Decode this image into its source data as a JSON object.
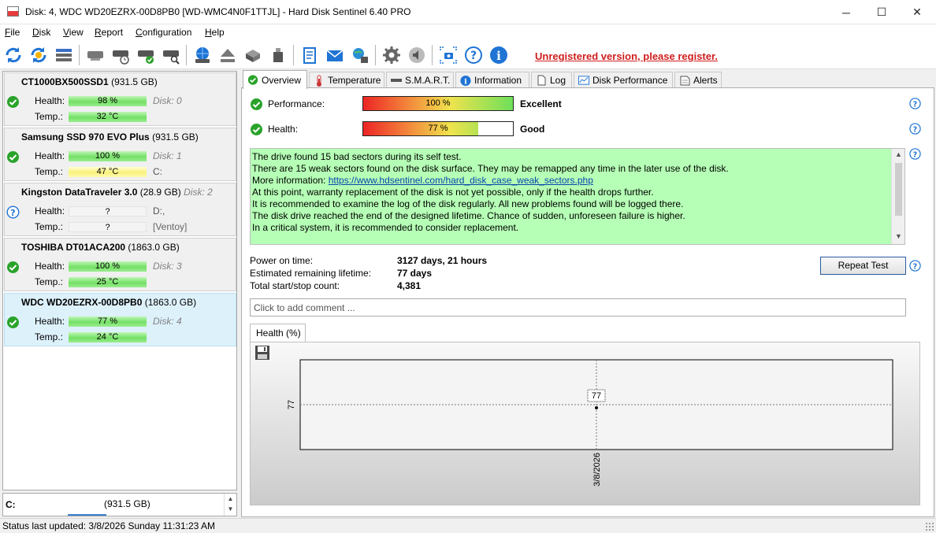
{
  "window": {
    "title": "Disk: 4, WDC WD20EZRX-00D8PB0 [WD-WMC4N0F1TTJL]  -  Hard Disk Sentinel 6.40 PRO",
    "minimize": "─",
    "maximize": "☐",
    "close": "✕"
  },
  "menu": [
    "File",
    "Disk",
    "View",
    "Report",
    "Configuration",
    "Help"
  ],
  "toolbar": {
    "buttons": [
      "refresh-icon",
      "refresh-all-icon",
      "disk-list-icon",
      "disk-icon",
      "disk-timer-icon",
      "disk-check-icon",
      "disk-search-icon",
      "network-disk-icon",
      "eject-icon",
      "server-icon",
      "usb-icon",
      "report-icon",
      "mail-icon",
      "network-icon",
      "settings-icon",
      "sound-icon",
      "screenshot-icon",
      "help-icon",
      "info-icon"
    ],
    "unregistered": "Unregistered version, please register."
  },
  "disks": [
    {
      "model": "CT1000BX500SSD1",
      "size": "(931.5 GB)",
      "health_label": "Health:",
      "health": "98 %",
      "health_fill": 98,
      "temp_label": "Temp.:",
      "temp": "32 °C",
      "temp_color": "green",
      "disk_no": "Disk: 0",
      "volume": "",
      "status": "ok",
      "selected": false
    },
    {
      "model": "Samsung SSD 970 EVO Plus",
      "size": "(931.5 GB)",
      "health_label": "Health:",
      "health": "100 %",
      "health_fill": 100,
      "temp_label": "Temp.:",
      "temp": "47 °C",
      "temp_color": "yellow",
      "disk_no": "Disk: 1",
      "volume": "C:",
      "status": "ok",
      "selected": false
    },
    {
      "model": "Kingston DataTraveler 3.0",
      "size": "(28.9 GB)",
      "title_disk": "Disk: 2",
      "health_label": "Health:",
      "health": "?",
      "health_fill": 0,
      "temp_label": "Temp.:",
      "temp": "?",
      "temp_color": "empty",
      "disk_no": "D:,",
      "volume": "[Ventoy]",
      "status": "unknown",
      "selected": false
    },
    {
      "model": "TOSHIBA DT01ACA200",
      "size": "(1863.0 GB)",
      "health_label": "Health:",
      "health": "100 %",
      "health_fill": 100,
      "temp_label": "Temp.:",
      "temp": "25 °C",
      "temp_color": "green",
      "disk_no": "Disk: 3",
      "volume": "",
      "status": "ok",
      "selected": false
    },
    {
      "model": "WDC WD20EZRX-00D8PB0",
      "size": "(1863.0 GB)",
      "health_label": "Health:",
      "health": "77 %",
      "health_fill": 77,
      "temp_label": "Temp.:",
      "temp": "24 °C",
      "temp_color": "green",
      "disk_no": "Disk: 4",
      "volume": "",
      "status": "ok",
      "selected": true
    }
  ],
  "volume_panel": {
    "letter": "C:",
    "size": "(931.5 GB)",
    "used_percent": 50
  },
  "tabs": [
    {
      "label": "Overview",
      "icon": "check-circle-icon",
      "active": true
    },
    {
      "label": "Temperature",
      "icon": "thermometer-icon",
      "active": false
    },
    {
      "label": "S.M.A.R.T.",
      "icon": "smart-icon",
      "active": false
    },
    {
      "label": "Information",
      "icon": "info-icon",
      "active": false
    },
    {
      "label": "Log",
      "icon": "log-icon",
      "active": false
    },
    {
      "label": "Disk Performance",
      "icon": "chart-icon",
      "active": false
    },
    {
      "label": "Alerts",
      "icon": "alert-icon",
      "active": false
    }
  ],
  "overview": {
    "performance_label": "Performance:",
    "performance_value": "100 %",
    "performance_fill": 100,
    "performance_result": "Excellent",
    "health_label": "Health:",
    "health_value": "77 %",
    "health_fill": 77,
    "health_result": "Good",
    "messages": [
      "The drive found 15 bad sectors during its self test.",
      "There are 15 weak sectors found on the disk surface. They may be remapped any time in the later use of the disk.",
      "At this point, warranty replacement of the disk is not yet possible, only if the health drops further.",
      "It is recommended to examine the log of the disk regularly. All new problems found will be logged there.",
      "The disk drive reached the end of the designed lifetime. Chance of sudden, unforeseen failure is higher.",
      "In a critical system, it is recommended to consider replacement."
    ],
    "more_info_label": "More information: ",
    "more_info_link": "https://www.hdsentinel.com/hard_disk_case_weak_sectors.php",
    "power_on_label": "Power on time:",
    "power_on_value": "3127 days, 21 hours",
    "lifetime_label": "Estimated remaining lifetime:",
    "lifetime_value": "77 days",
    "startstop_label": "Total start/stop count:",
    "startstop_value": "4,381",
    "repeat_test": "Repeat Test",
    "comment_placeholder": "Click to add comment ...",
    "health_tab": "Health (%)"
  },
  "chart_data": {
    "type": "line",
    "x": [
      "3/8/2026"
    ],
    "series": [
      {
        "values": [
          77
        ]
      }
    ],
    "data_labels": [
      "77"
    ],
    "ytick_labels": [
      "77"
    ],
    "xtick_labels": [
      "3/8/2026"
    ],
    "grid": true
  },
  "status": {
    "text": "Status last updated: 3/8/2026 Sunday 11:31:23 AM"
  }
}
